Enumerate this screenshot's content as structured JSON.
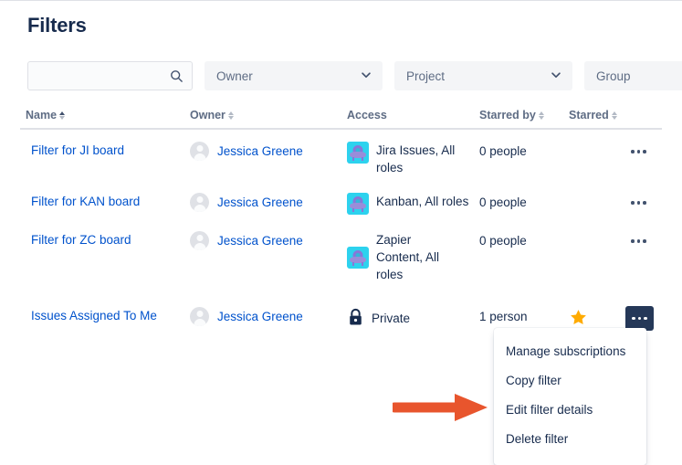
{
  "page": {
    "title": "Filters"
  },
  "search": {
    "value": "",
    "placeholder": "",
    "icon": "search-icon"
  },
  "filters": [
    {
      "label": "Owner",
      "icon": "chevron-down-icon",
      "has_chevron": true
    },
    {
      "label": "Project",
      "icon": "chevron-down-icon",
      "has_chevron": true
    },
    {
      "label": "Group",
      "icon": "chevron-down-icon",
      "has_chevron": false
    }
  ],
  "table": {
    "columns": [
      {
        "label": "Name",
        "sortable": true,
        "sort": "asc"
      },
      {
        "label": "Owner",
        "sortable": true,
        "sort": "none"
      },
      {
        "label": "Access",
        "sortable": false,
        "sort": "none"
      },
      {
        "label": "Starred by",
        "sortable": true,
        "sort": "none"
      },
      {
        "label": "Starred",
        "sortable": true,
        "sort": "none"
      },
      {
        "label": "",
        "sortable": false,
        "sort": "none"
      }
    ],
    "rows": [
      {
        "name": "Filter for JI board",
        "owner": "Jessica Greene",
        "owner_avatar": "person-avatar-icon",
        "access": "Jira Issues, All roles",
        "access_icon": "project-avatar-icon",
        "starred_by": "0 people",
        "starred": false,
        "menu_open": false
      },
      {
        "name": "Filter for KAN board",
        "owner": "Jessica Greene",
        "owner_avatar": "person-avatar-icon",
        "access": "Kanban, All roles",
        "access_icon": "project-avatar-icon",
        "starred_by": "0 people",
        "starred": false,
        "menu_open": false
      },
      {
        "name": "Filter for ZC board",
        "owner": "Jessica Greene",
        "owner_avatar": "person-avatar-icon",
        "access": "Zapier Content, All roles",
        "access_icon": "project-avatar-icon",
        "starred_by": "0 people",
        "starred": false,
        "menu_open": false
      },
      {
        "name": "Issues Assigned To Me",
        "owner": "Jessica Greene",
        "owner_avatar": "person-avatar-icon",
        "access": "Private",
        "access_icon": "lock-icon",
        "starred_by": "1 person",
        "starred": true,
        "menu_open": true
      }
    ]
  },
  "context_menu": {
    "items": [
      "Manage subscriptions",
      "Copy filter",
      "Edit filter details",
      "Delete filter"
    ]
  },
  "annotation": {
    "type": "arrow-right",
    "points_to": "Edit filter details",
    "color": "#E8552D"
  },
  "colors": {
    "link": "#0052CC",
    "text": "#172B4D",
    "muted": "#5E6C84",
    "border": "#DFE1E6",
    "chip_bg": "#F4F5F7",
    "star": "#FFAB00",
    "active_button": "#253858",
    "project_avatar": "#2DD2EE",
    "annotation": "#E8552D"
  }
}
